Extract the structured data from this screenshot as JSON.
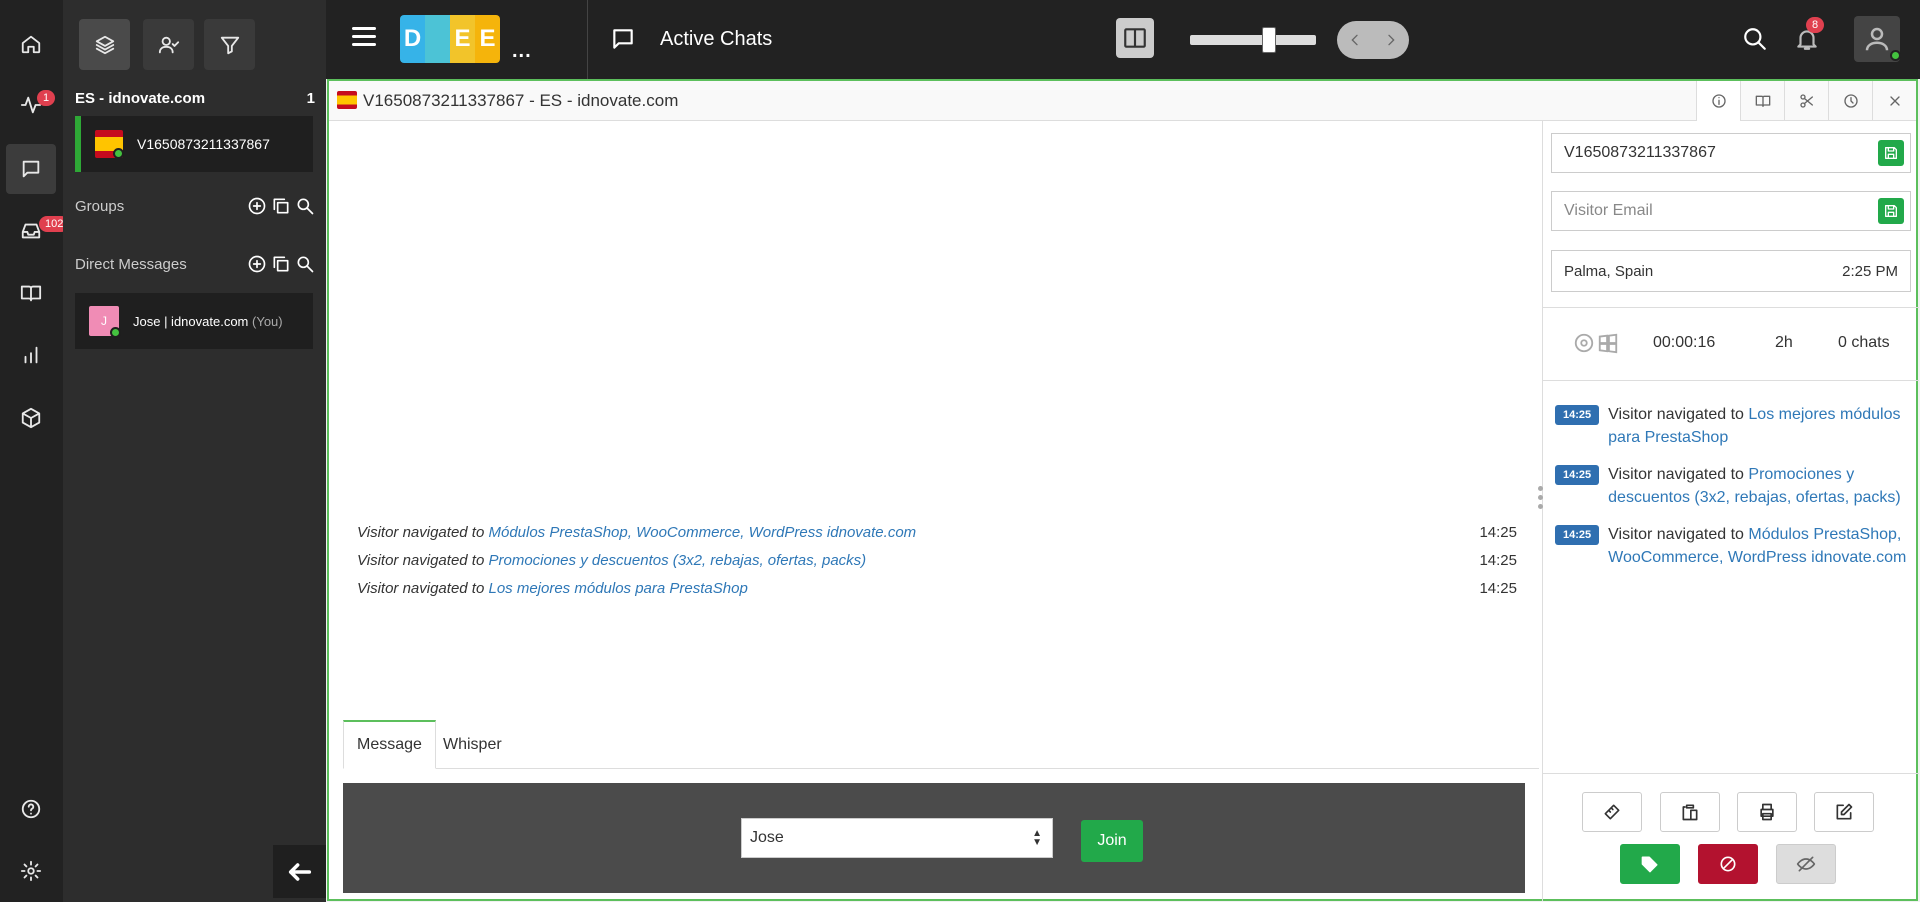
{
  "rail": {
    "badges": {
      "activity": "1",
      "inbox": "102"
    }
  },
  "chatlist": {
    "department": {
      "name": "ES - idnovate.com",
      "count": "1"
    },
    "active_chat": {
      "label": "V1650873211337867"
    },
    "groups_label": "Groups",
    "direct_messages_label": "Direct Messages",
    "dm_user": {
      "initial": "J",
      "name": "Jose | idnovate.com",
      "suffix": "(You)"
    }
  },
  "topbar": {
    "logo_letters": [
      "D",
      "",
      "E",
      "E"
    ],
    "logo_colors": [
      "#36b3e8",
      "#4cc3d6",
      "#f2c42a",
      "#f5b40b"
    ],
    "more": "...",
    "title": "Active Chats",
    "notification_count": "8",
    "zoom_fraction": 0.64
  },
  "chat": {
    "title": "V1650873211337867 - ES - idnovate.com",
    "messages": [
      {
        "prefix": "Visitor navigated to",
        "link": "Módulos PrestaShop, WooCommerce, WordPress idnovate.com",
        "time": "14:25"
      },
      {
        "prefix": "Visitor navigated to",
        "link": "Promociones y descuentos (3x2, rebajas, ofertas, packs)",
        "time": "14:25"
      },
      {
        "prefix": "Visitor navigated to",
        "link": "Los mejores módulos para PrestaShop",
        "time": "14:25"
      }
    ],
    "tabs": {
      "message": "Message",
      "whisper": "Whisper"
    },
    "operator_select": "Jose",
    "join_label": "Join"
  },
  "side": {
    "nick_value": "V1650873211337867",
    "email_placeholder": "Visitor Email",
    "location": "Palma, Spain",
    "local_time": "2:25 PM",
    "stats": {
      "duration": "00:00:16",
      "time_on_site": "2h",
      "chats": "0 chats"
    },
    "navigation": [
      {
        "time": "14:25",
        "prefix": "Visitor navigated to",
        "link": "Los mejores módulos para PrestaShop"
      },
      {
        "time": "14:25",
        "prefix": "Visitor navigated to",
        "link": "Promociones y descuentos (3x2, rebajas, ofertas, packs)"
      },
      {
        "time": "14:25",
        "prefix": "Visitor navigated to",
        "link": "Módulos PrestaShop, WooCommerce, WordPress idnovate.com"
      }
    ]
  },
  "colors": {
    "accent_green": "#22a94a",
    "link_blue": "#2f78b7",
    "badge_red": "#e0404f",
    "danger": "#b3122f"
  }
}
